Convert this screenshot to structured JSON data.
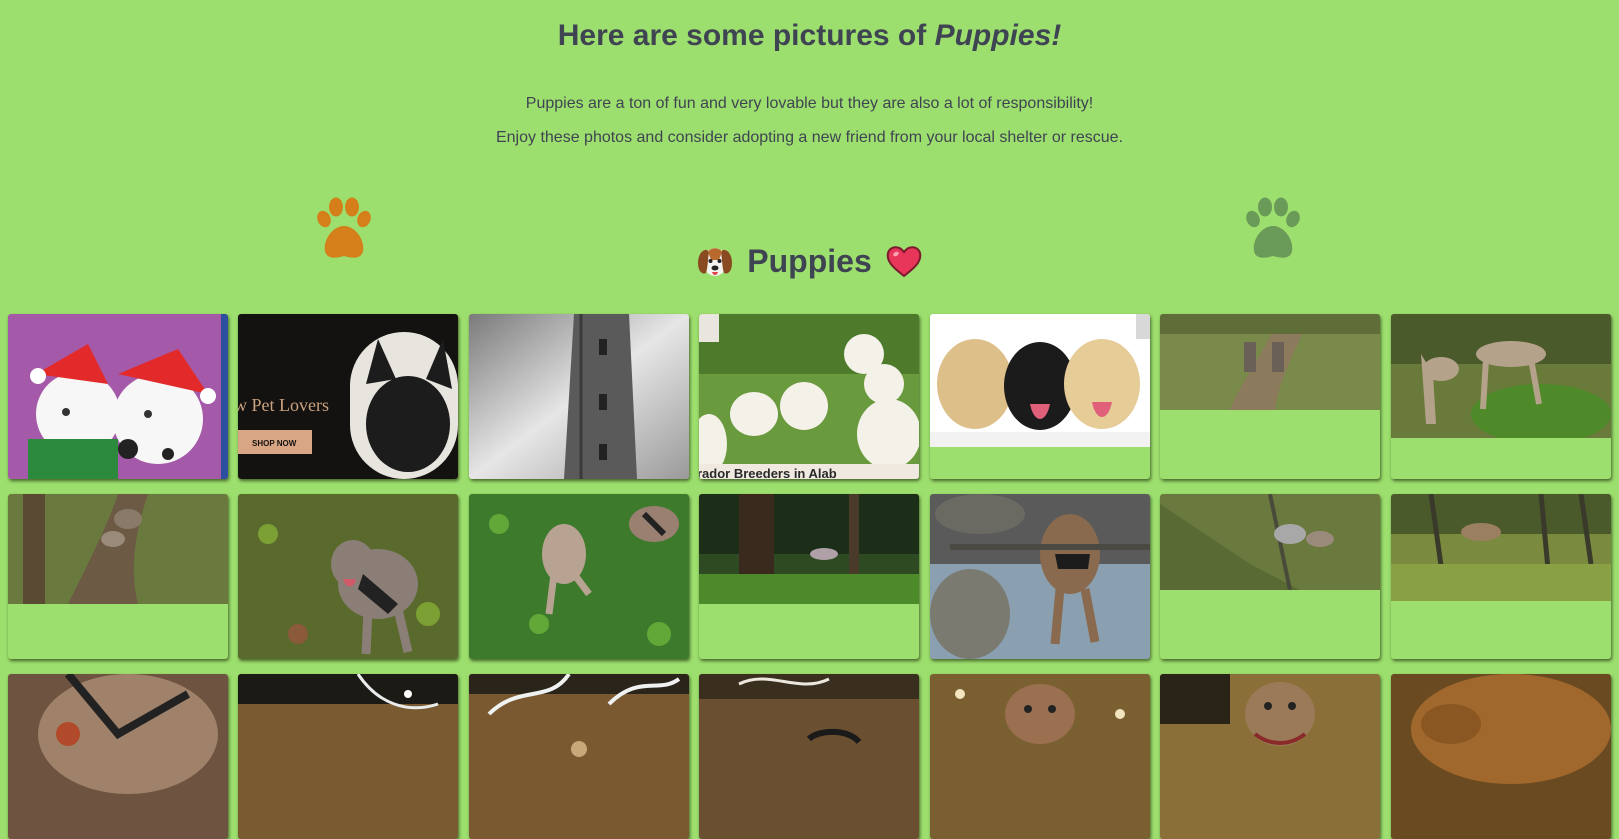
{
  "header": {
    "title_prefix": "Here are some pictures of",
    "title_emphasis": "Puppies!",
    "intro_line1": "Puppies are a ton of fun and very lovable but they are also a lot of responsibility!",
    "intro_line2": "Enjoy these photos and consider adopting a new friend from your local shelter or rescue."
  },
  "section": {
    "label": "Puppies",
    "left_emoji": "dog-face-icon",
    "right_emoji": "heart-icon"
  },
  "decor": {
    "left_paw": "paw-print-icon",
    "right_paw": "paw-print-icon",
    "left_paw_color": "#d47f1a",
    "right_paw_color": "#6a9a57"
  },
  "colors": {
    "background": "#9ddf6e",
    "text": "#3f4452"
  },
  "gallery": [
    {
      "subject": "Cartoon dalmatian puppies in Santa hats",
      "caption": ""
    },
    {
      "subject": "Pet store ad with French bulldog",
      "caption": "w Pet Lovers",
      "button": "SHOP NOW"
    },
    {
      "subject": "Black and white stone tower",
      "caption": ""
    },
    {
      "subject": "White Labrador puppies on grass",
      "caption": "rador Breeders in Alab"
    },
    {
      "subject": "Three Labrador puppies",
      "caption": ""
    },
    {
      "subject": "Two dogs on a forest trail",
      "caption": ""
    },
    {
      "subject": "Two dogs on mossy forest floor",
      "caption": ""
    },
    {
      "subject": "Dogs running on a forest path",
      "caption": ""
    },
    {
      "subject": "Dog in harness among leaves",
      "caption": ""
    },
    {
      "subject": "Dogs running on green clover",
      "caption": ""
    },
    {
      "subject": "Dog running in pine forest",
      "caption": ""
    },
    {
      "subject": "Dog standing in stream",
      "caption": ""
    },
    {
      "subject": "Dog running through forest undergrowth",
      "caption": ""
    },
    {
      "subject": "Dog in tall grass",
      "caption": ""
    },
    {
      "subject": "Dog close-up with harness",
      "caption": ""
    },
    {
      "subject": "Water splash in stream",
      "caption": ""
    },
    {
      "subject": "Dog splashing in stream",
      "caption": ""
    },
    {
      "subject": "Dog splashing in water",
      "caption": ""
    },
    {
      "subject": "Dog in water looking at camera",
      "caption": ""
    },
    {
      "subject": "Dog with collar in water",
      "caption": ""
    },
    {
      "subject": "Brown dog close-up",
      "caption": ""
    }
  ]
}
